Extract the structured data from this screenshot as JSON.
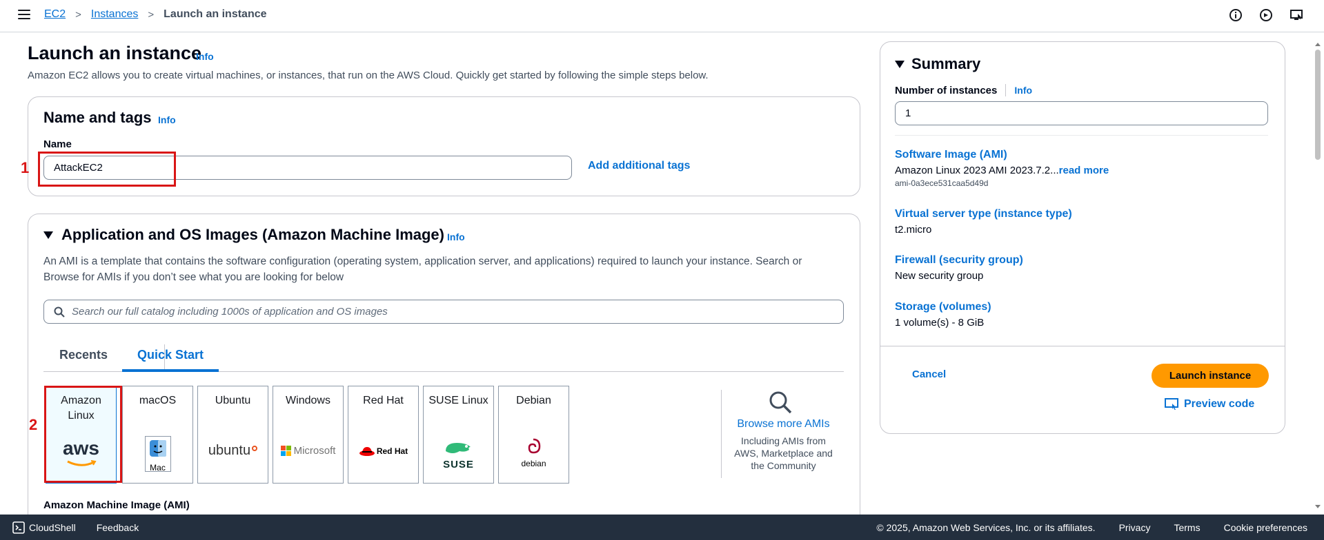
{
  "breadcrumb": {
    "root": "EC2",
    "parent": "Instances",
    "current": "Launch an instance"
  },
  "page": {
    "title": "Launch an instance",
    "info": "Info",
    "subtitle": "Amazon EC2 allows you to create virtual machines, or instances, that run on the AWS Cloud. Quickly get started by following the simple steps below."
  },
  "name_tags": {
    "heading": "Name and tags",
    "info": "Info",
    "name_label": "Name",
    "name_value": "AttackEC2",
    "add_tags": "Add additional tags",
    "annotation": "1"
  },
  "ami": {
    "heading": "Application and OS Images (Amazon Machine Image)",
    "info": "Info",
    "description_line1": "An AMI is a template that contains the software configuration (operating system, application server, and applications) required to launch your instance. Search or",
    "description_line2": "Browse for AMIs if you don’t see what you are looking for below",
    "search_placeholder": "Search our full catalog including 1000s of application and OS images",
    "tabs": [
      "Recents",
      "Quick Start"
    ],
    "cards": [
      {
        "name_line1": "Amazon",
        "name_line2": "Linux",
        "logo_text": "aws"
      },
      {
        "name_line1": "macOS",
        "name_line2": "",
        "logo_text": "Mac"
      },
      {
        "name_line1": "Ubuntu",
        "name_line2": "",
        "logo_text": "ubuntu"
      },
      {
        "name_line1": "Windows",
        "name_line2": "",
        "logo_text": "Microsoft"
      },
      {
        "name_line1": "Red Hat",
        "name_line2": "",
        "logo_text": "Red Hat"
      },
      {
        "name_line1": "SUSE Linux",
        "name_line2": "",
        "logo_text": "SUSE"
      },
      {
        "name_line1": "Debian",
        "name_line2": "",
        "logo_text": "debian"
      }
    ],
    "browse_title": "Browse more AMIs",
    "browse_desc_1": "Including AMIs from",
    "browse_desc_2": "AWS, Marketplace and",
    "browse_desc_3": "the Community",
    "section_label": "Amazon Machine Image (AMI)",
    "annotation": "2"
  },
  "summary": {
    "title": "Summary",
    "instances_label": "Number of instances",
    "instances_info": "Info",
    "instances_value": "1",
    "software_label": "Software Image (AMI)",
    "software_value": "Amazon Linux 2023 AMI 2023.7.2...",
    "software_more": "read more",
    "software_id": "ami-0a3ece531caa5d49d",
    "server_label": "Virtual server type (instance type)",
    "server_value": "t2.micro",
    "firewall_label": "Firewall (security group)",
    "firewall_value": "New security group",
    "storage_label": "Storage (volumes)",
    "storage_value": "1 volume(s) - 8 GiB",
    "cancel": "Cancel",
    "launch": "Launch instance",
    "preview": "Preview code"
  },
  "footer": {
    "cloudshell": "CloudShell",
    "feedback": "Feedback",
    "copyright": "© 2025, Amazon Web Services, Inc. or its affiliates.",
    "privacy": "Privacy",
    "terms": "Terms",
    "cookies": "Cookie preferences"
  },
  "colors": {
    "link": "#0972d3",
    "primary": "#ff9900",
    "annotation": "#d91515",
    "footer_bg": "#232f3e"
  }
}
